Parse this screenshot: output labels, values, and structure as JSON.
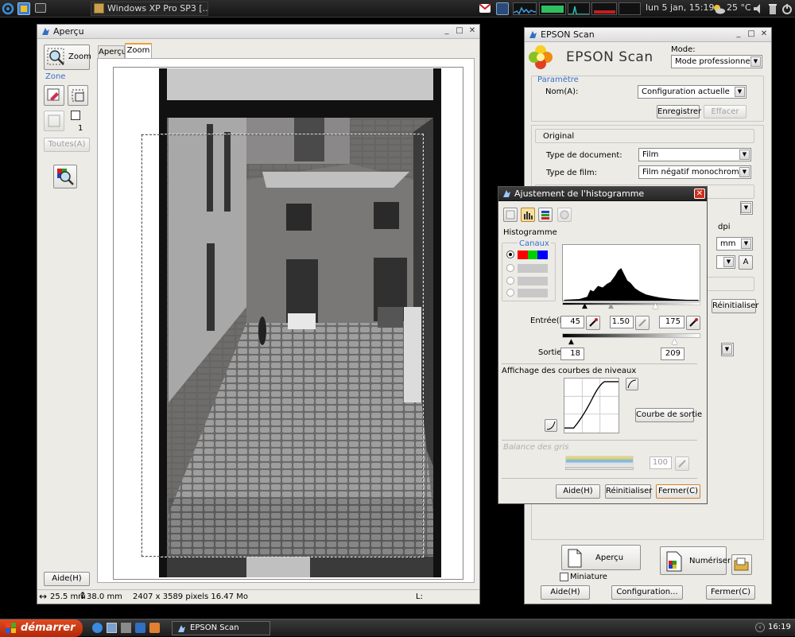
{
  "top_panel": {
    "vm_task": "Windows XP Pro SP3 [...",
    "clock": "lun  5 jan, 15:19",
    "temperature": "25 °C",
    "icons": [
      "debian-swirl-icon",
      "app-launcher-icon",
      "window-icon",
      "gmail-icon",
      "network-icon",
      "cpu-meter",
      "memory-meter",
      "net-meter",
      "weather-icon",
      "volume-icon",
      "trash-icon",
      "power-icon"
    ]
  },
  "apercu": {
    "title": "Aperçu",
    "zoom_label": "Zoom",
    "zone_label": "Zone",
    "zone_count": "1",
    "toutes_label": "Toutes(A)",
    "tabs": [
      "Aperçu",
      "Zoom"
    ],
    "aide_label": "Aide(H)",
    "status": {
      "width": "25.5 mm",
      "height": "38.0 mm",
      "pixels": "2407 x 3589 pixels 16.47 Mo",
      "l_label": "L:"
    }
  },
  "epson": {
    "title": "EPSON Scan",
    "logo_text": "EPSON Scan",
    "mode_label": "Mode:",
    "mode_value": "Mode professionnel",
    "parametre_label": "Paramètre",
    "nom_label": "Nom(A):",
    "nom_value": "Configuration actuelle",
    "enregistrer_label": "Enregistrer",
    "effacer_label": "Effacer",
    "original_label": "Original",
    "type_doc_label": "Type de document:",
    "type_doc_value": "Film",
    "type_film_label": "Type de film:",
    "type_film_value": "Film négatif monochrome",
    "dpi_label": "dpi",
    "unit_value": "mm",
    "reinitialiser_label": "Réinitialiser",
    "apercu_label": "Aperçu",
    "numeriser_label": "Numériser",
    "miniature_label": "Miniature",
    "aide_label": "Aide(H)",
    "configuration_label": "Configuration...",
    "fermer_label": "Fermer(C)"
  },
  "histogram": {
    "title": "Ajustement de l'histogramme",
    "section_label": "Histogramme",
    "canaux_label": "Canaux",
    "entree_label": "Entrée(I):",
    "entree_low": "45",
    "entree_gamma": "1.50",
    "entree_high": "175",
    "sortie_label": "Sortie:",
    "sortie_low": "18",
    "sortie_high": "209",
    "courbes_label": "Affichage des courbes de niveaux",
    "courbe_sortie_label": "Courbe de sortie",
    "balance_label": "Balance des gris",
    "balance_value": "100",
    "aide_label": "Aide(H)",
    "reinitialiser_label": "Réinitialiser",
    "fermer_label": "Fermer(C)"
  },
  "taskbar": {
    "start_label": "démarrer",
    "task_label": "EPSON Scan",
    "clock": "16:19"
  }
}
